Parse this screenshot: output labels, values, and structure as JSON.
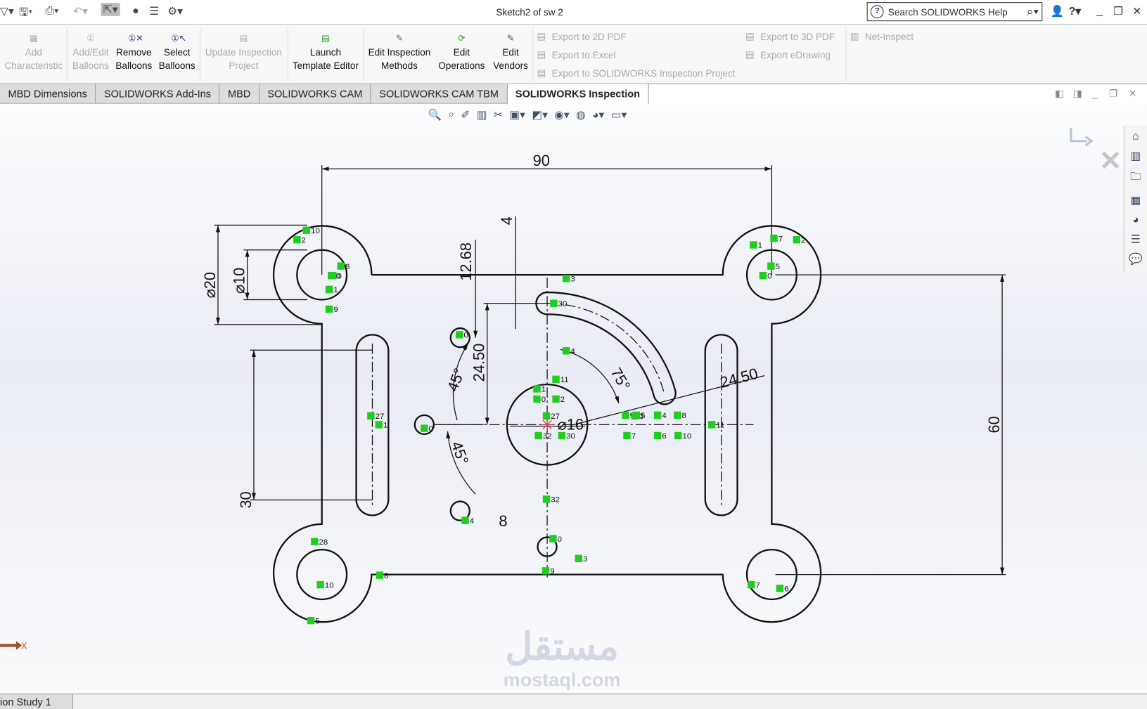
{
  "window": {
    "title": "Sketch2 of sw 2",
    "search_placeholder": "Search SOLIDWORKS Help"
  },
  "quick_access": [
    {
      "icon": "new-icon"
    },
    {
      "icon": "save-icon"
    },
    {
      "icon": "print-icon"
    },
    {
      "icon": "undo-icon"
    },
    {
      "icon": "select-icon"
    },
    {
      "icon": "rebuild-icon"
    },
    {
      "icon": "file-properties-icon"
    },
    {
      "icon": "options-icon"
    }
  ],
  "ribbon": {
    "buttons": [
      {
        "label1": "Add",
        "label2": "Characteristic",
        "enabled": false
      },
      {
        "label1": "Add/Edit",
        "label2": "Balloons",
        "enabled": false
      },
      {
        "label1": "Remove",
        "label2": "Balloons",
        "enabled": true
      },
      {
        "label1": "Select",
        "label2": "Balloons",
        "enabled": true
      },
      {
        "label1": "Update Inspection",
        "label2": "Project",
        "enabled": false
      },
      {
        "label1": "Launch",
        "label2": "Template Editor",
        "enabled": true
      },
      {
        "label1": "Edit Inspection",
        "label2": "Methods",
        "enabled": true
      },
      {
        "label1": "Edit",
        "label2": "Operations",
        "enabled": true
      },
      {
        "label1": "Edit",
        "label2": "Vendors",
        "enabled": true
      }
    ],
    "exports": [
      "Export to 2D PDF",
      "Export to Excel",
      "Export to SOLIDWORKS Inspection Project",
      "Export to 3D PDF",
      "Export eDrawing",
      "Net-Inspect"
    ]
  },
  "tabs": [
    {
      "label": "MBD Dimensions",
      "active": false
    },
    {
      "label": "SOLIDWORKS Add-Ins",
      "active": false
    },
    {
      "label": "MBD",
      "active": false
    },
    {
      "label": "SOLIDWORKS CAM",
      "active": false
    },
    {
      "label": "SOLIDWORKS CAM TBM",
      "active": false
    },
    {
      "label": "SOLIDWORKS Inspection",
      "active": true
    }
  ],
  "sketch": {
    "dimensions": {
      "width": "90",
      "height": "60",
      "outer_dia": "⌀20",
      "inner_dia": "⌀10",
      "slot_len": "30",
      "offset": "12.68",
      "vert": "24.50",
      "small": "4",
      "angle1": "45°",
      "angle2": "45°",
      "arc_angle": "75°",
      "center_dia": "⌀16",
      "radial": "24.50",
      "eight": "8"
    },
    "relations": [
      "10",
      "2",
      "0",
      "1",
      "9",
      "8",
      "3",
      "7",
      "2",
      "1",
      "5",
      "0",
      "30",
      "4",
      "11",
      "1",
      "0",
      "2",
      "27",
      "32",
      "30",
      "9",
      "5",
      "3",
      "4",
      "8",
      "7",
      "6",
      "10",
      "11",
      "27",
      "1",
      "0",
      "0",
      "0",
      "4",
      "32",
      "0",
      "3",
      "9",
      "28",
      "8",
      "10",
      "5",
      "7",
      "6"
    ],
    "axis_label": "X"
  },
  "status": {
    "tab": "ion Study 1"
  },
  "watermark": {
    "arabic": "مستقل",
    "latin": "mostaql.com"
  },
  "colors": {
    "relation": "#22cc22",
    "sketch": "#111111",
    "accent": "#1f4e9a"
  }
}
